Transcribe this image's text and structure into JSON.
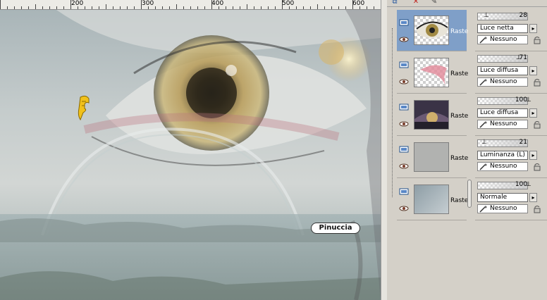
{
  "ruler": {
    "labels": [
      "200",
      "300",
      "400",
      "500",
      "600"
    ]
  },
  "canvas": {
    "signature": "Pinuccia"
  },
  "toolbar": {
    "icons": [
      "new-layer-icon",
      "delete-layer-icon",
      "properties-icon"
    ]
  },
  "layers": [
    {
      "name": "Raste",
      "selected": true,
      "opacity": "28",
      "blend": "Luce netta",
      "mask": "Nessuno"
    },
    {
      "name": "Raste",
      "selected": false,
      "opacity": "71",
      "blend": "Luce diffusa",
      "mask": "Nessuno"
    },
    {
      "name": "Raste",
      "selected": false,
      "opacity": "100",
      "blend": "Luce diffusa",
      "mask": "Nessuno"
    },
    {
      "name": "Raste",
      "selected": false,
      "opacity": "21",
      "blend": "Luminanza (L)",
      "mask": "Nessuno"
    },
    {
      "name": "Raste",
      "selected": false,
      "opacity": "100",
      "blend": "Normale",
      "mask": "Nessuno"
    }
  ],
  "colors": {
    "selected_row": "#7f9fc8",
    "panel": "#d4d0c8"
  }
}
